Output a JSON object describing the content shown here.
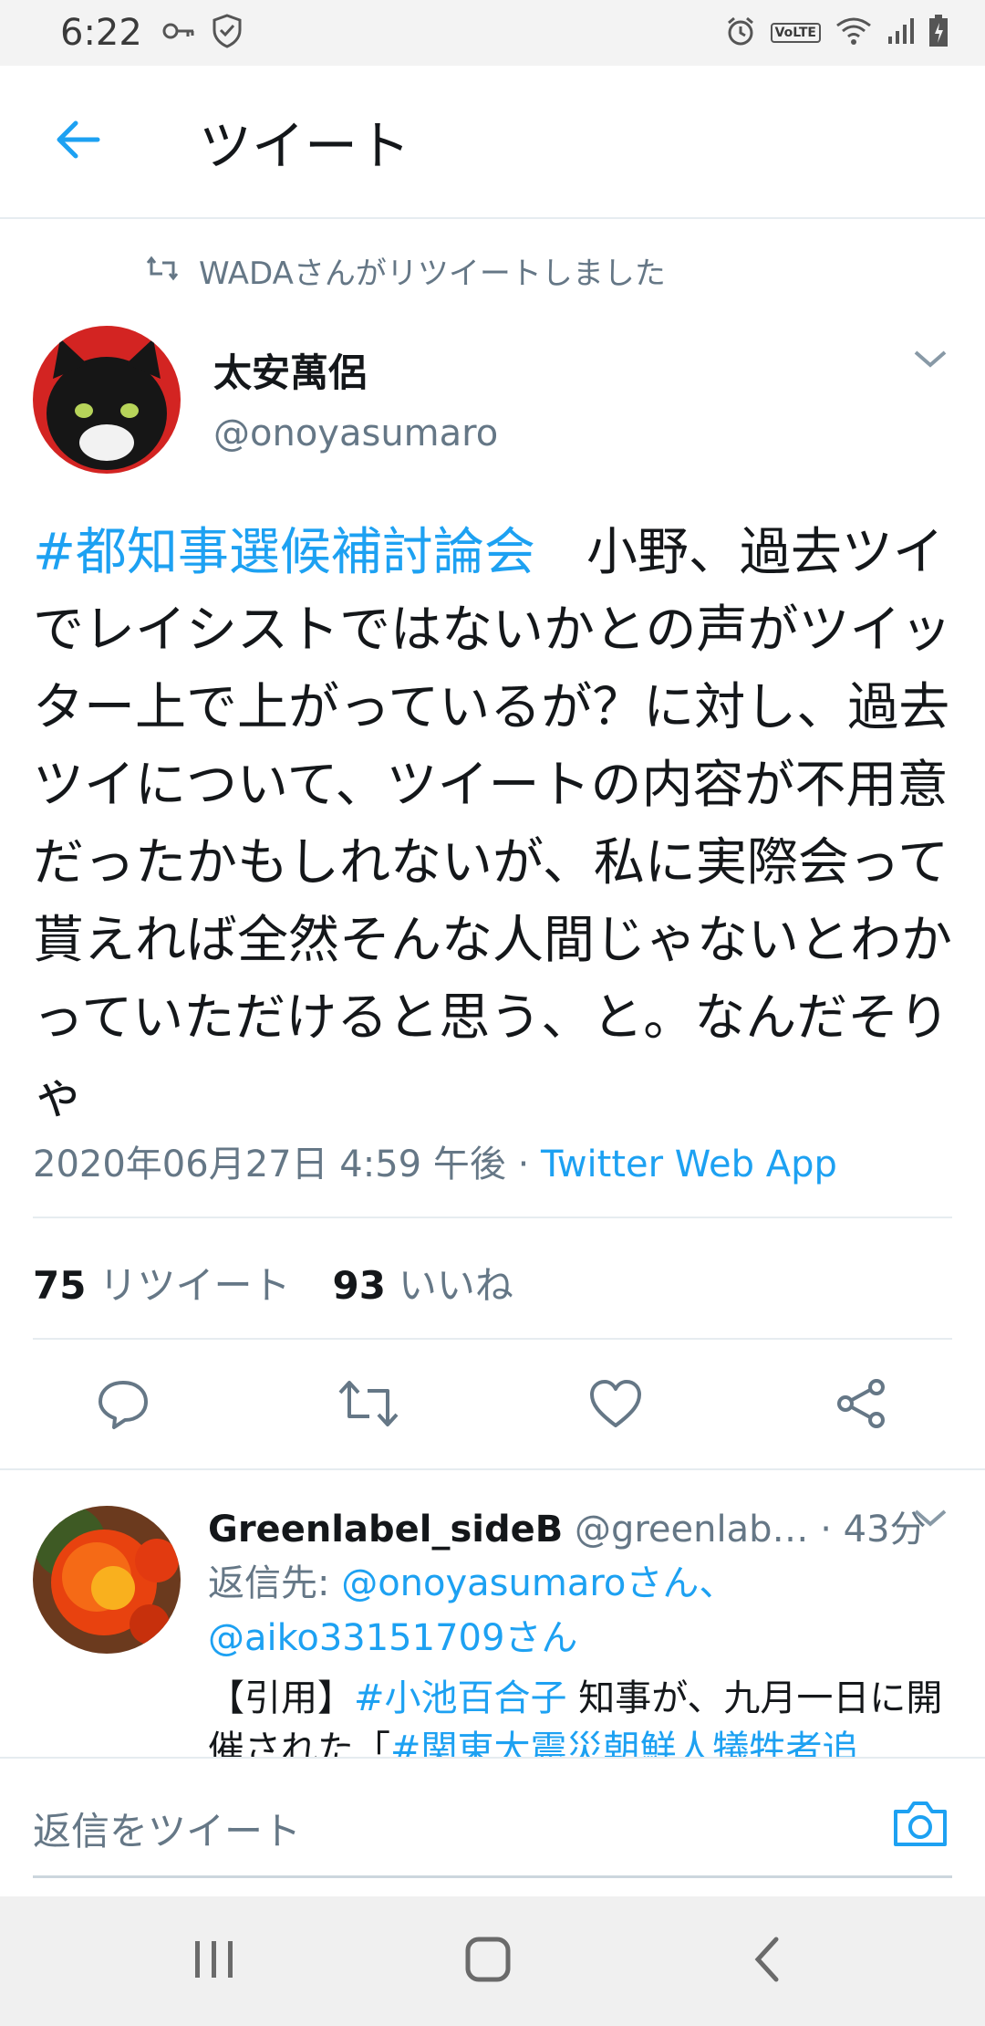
{
  "status_bar": {
    "time": "6:22",
    "volte": "VoLTE"
  },
  "header": {
    "title": "ツイート"
  },
  "retweet_note": "WADAさんがリツイートしました",
  "tweet": {
    "author_name": "太安萬侶",
    "author_handle": "@onoyasumaro",
    "hashtag": "#都知事選候補討論会",
    "text": "　小野、過去ツイでレイシストではないかとの声がツイッター上で上がっているが？に対し、過去ツイについて、ツイートの内容が不用意だったかもしれないが、私に実際会って貰えれば全然そんな人間じゃないとわかっていただけると思う、と。なんだそりゃ",
    "timestamp": "2020年06月27日 4:59 午後",
    "separator": " · ",
    "client": "Twitter Web App",
    "retweet_count": "75",
    "retweet_label": "リツイート",
    "like_count": "93",
    "like_label": "いいね"
  },
  "reply": {
    "name": "Greenlabel_sideB",
    "handle": "@greenlab…",
    "time": " · 43分",
    "reply_to_prefix": "返信先: ",
    "reply_to_user1": "@onoyasumaroさん、",
    "reply_to_user2": "@aiko33151709さん",
    "body_prefix": "【引用】",
    "body_hashtag1": "#小池百合子",
    "body_text1": " 知事が、九月一日に開催された「",
    "body_hashtag2": "#関東大震災朝鮮人犠牲者追"
  },
  "compose": {
    "placeholder": "返信をツイート"
  },
  "colors": {
    "accent": "#1da1f2",
    "secondary_text": "#657786",
    "divider": "#e6ecf0"
  },
  "icons": {
    "back": "arrow-left-icon",
    "retweet_small": "retweet-icon",
    "chevron": "chevron-down-icon",
    "reply": "reply-icon",
    "retweet": "retweet-icon",
    "like": "heart-icon",
    "share": "share-icon",
    "camera": "camera-icon"
  }
}
